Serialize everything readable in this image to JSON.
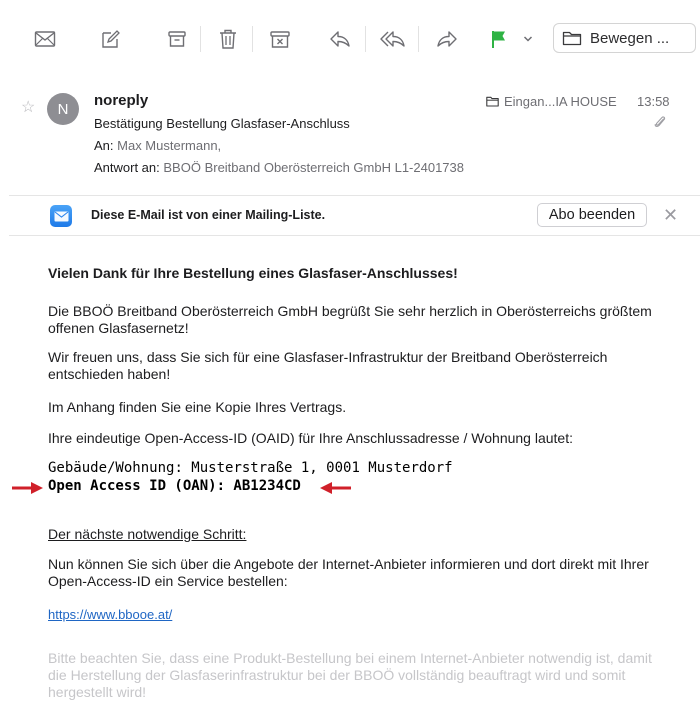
{
  "toolbar": {
    "move_label": "Bewegen ...",
    "flag_color": "#2fb344"
  },
  "message": {
    "avatar_initial": "N",
    "sender": "noreply",
    "subject": "Bestätigung Bestellung Glasfaser-Anschluss",
    "to_label": "An:",
    "to_value": "Max Mustermann,",
    "reply_label": "Antwort an:",
    "reply_value": "BBOÖ Breitband Oberösterreich GmbH L1-2401738",
    "folder": "Eingan...IA HOUSE",
    "time": "13:58"
  },
  "mailing_list": {
    "text": "Diese E-Mail ist von einer Mailing-Liste.",
    "unsubscribe_label": "Abo beenden"
  },
  "body": {
    "heading": "Vielen Dank für Ihre Bestellung eines Glasfaser-Anschlusses!",
    "p1": "Die BBOÖ Breitband Oberösterreich GmbH begrüßt Sie sehr herzlich in Oberösterreichs größtem offenen Glasfasernetz!",
    "p2": "Wir freuen uns, dass Sie sich für eine Glasfaser-Infrastruktur der Breitband Oberösterreich entschieden haben!",
    "p3": "Im Anhang finden Sie eine Kopie Ihres Vertrags.",
    "p4": "Ihre eindeutige Open-Access-ID (OAID) für Ihre Anschlussadresse / Wohnung lautet:",
    "address_label": "Gebäude/Wohnung",
    "address_value": ": Musterstraße 1, 0001 Musterdorf",
    "oan_line": "Open Access ID (OAN): AB1234CD",
    "next_step": "Der nächste notwendige Schritt:",
    "p5": "Nun können Sie sich über die Angebote der Internet-Anbieter informieren und dort direkt mit Ihrer Open-Access-ID ein Service bestellen:",
    "link": "https://www.bbooe.at/",
    "p6": "Bitte beachten Sie, dass eine Produkt-Bestellung bei einem Internet-Anbieter notwendig ist, damit die Herstellung der Glasfaserinfrastruktur bei der BBOÖ vollständig beauftragt wird und somit hergestellt wird!"
  },
  "colors": {
    "arrow": "#d0202a",
    "link": "#1f66c4"
  }
}
